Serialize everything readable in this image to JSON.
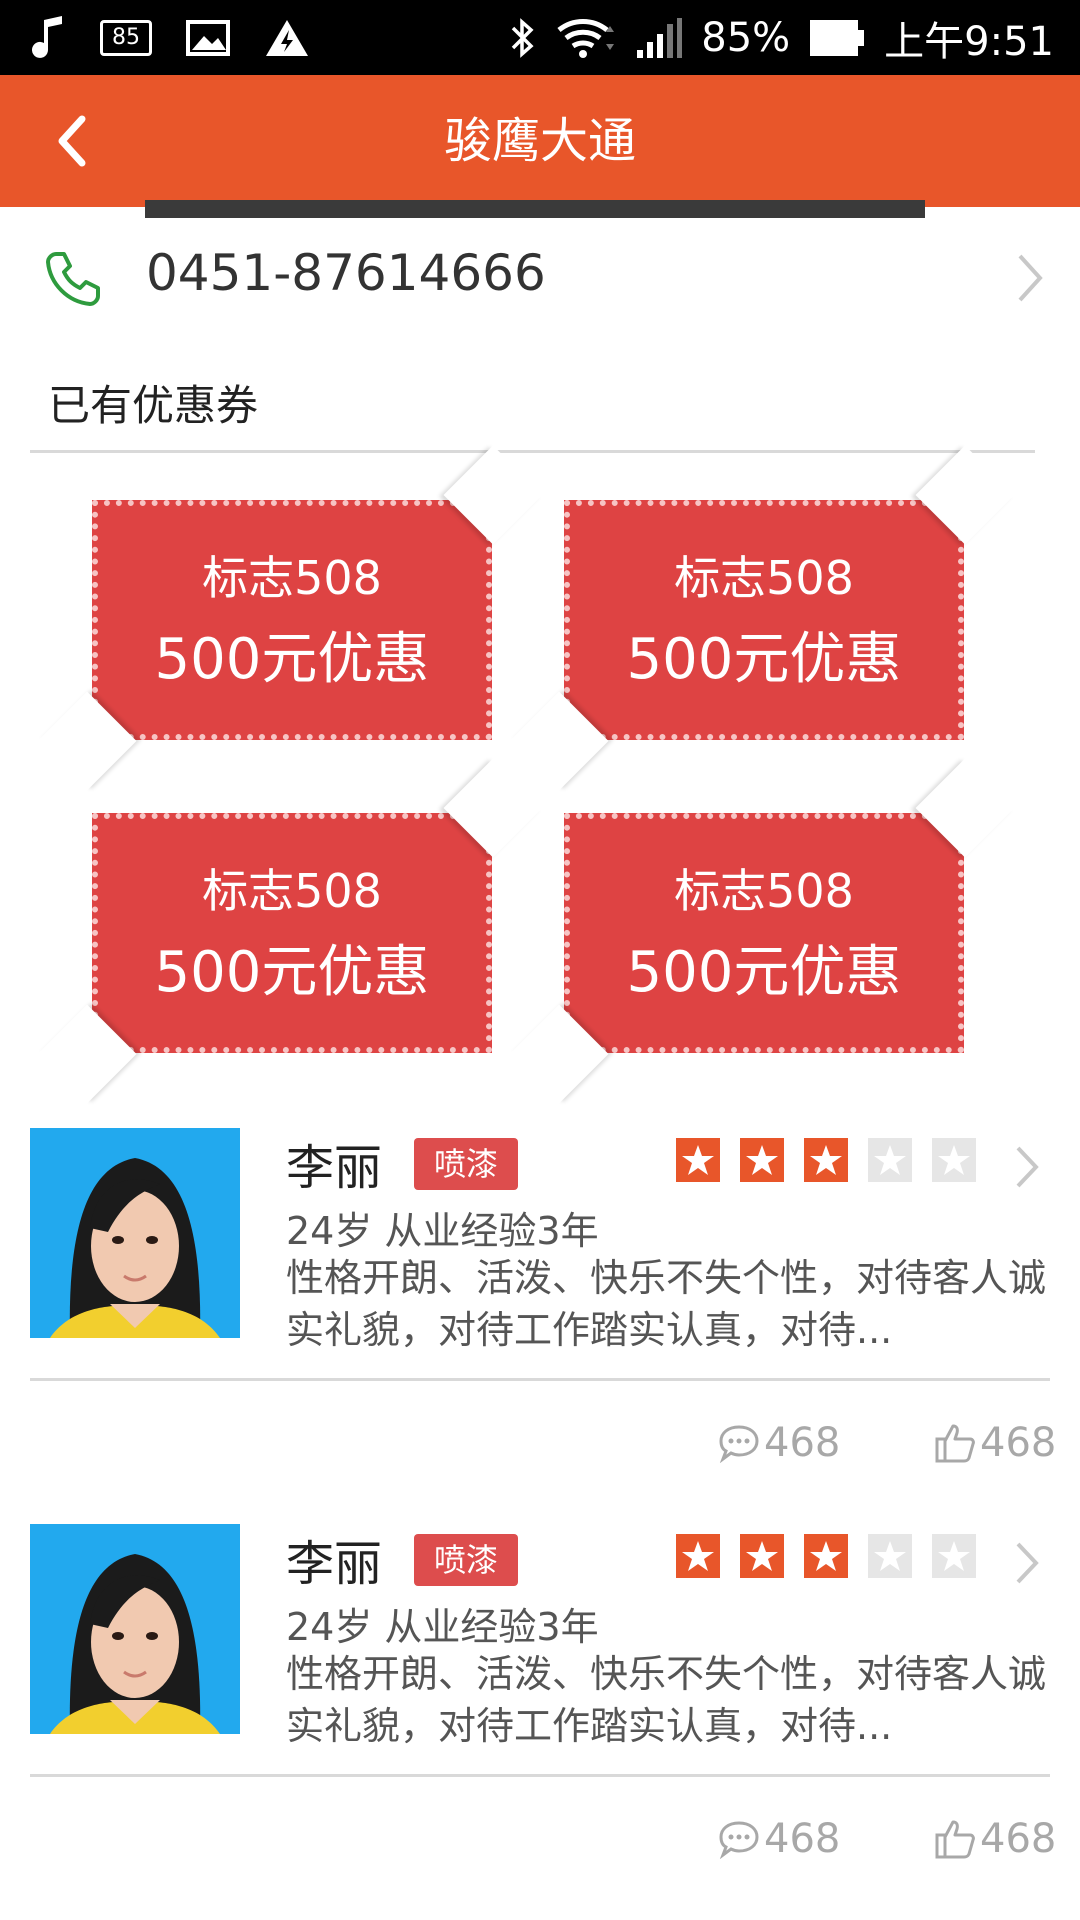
{
  "status_bar": {
    "battery_percent": "85%",
    "time": "上午9:51",
    "notification_badge": "85",
    "icons": [
      "music-note-icon",
      "notification-badge-icon",
      "image-icon",
      "warning-icon",
      "bluetooth-icon",
      "wifi-icon",
      "signal-icon",
      "battery-icon"
    ]
  },
  "header": {
    "title": "骏鹰大通",
    "back_icon": "chevron-left-icon"
  },
  "contact": {
    "phone": "0451-87614666",
    "phone_icon": "phone-icon"
  },
  "coupons_section": {
    "title": "已有优惠券",
    "coupons": [
      {
        "line1": "标志508",
        "line2": "500元优惠"
      },
      {
        "line1": "标志508",
        "line2": "500元优惠"
      },
      {
        "line1": "标志508",
        "line2": "500元优惠"
      },
      {
        "line1": "标志508",
        "line2": "500元优惠"
      }
    ]
  },
  "profiles": [
    {
      "name": "李丽",
      "tag": "喷漆",
      "rating": 3,
      "rating_max": 5,
      "age_experience": "24岁 从业经验3年",
      "description": "性格开朗、活泼、快乐不失个性，对待客人诚实礼貌，对待工作踏实认真，对待...",
      "comments": "468",
      "likes": "468"
    },
    {
      "name": "李丽",
      "tag": "喷漆",
      "rating": 3,
      "rating_max": 5,
      "age_experience": "24岁 从业经验3年",
      "description": "性格开朗、活泼、快乐不失个性，对待客人诚实礼貌，对待工作踏实认真，对待...",
      "comments": "468",
      "likes": "468"
    }
  ],
  "colors": {
    "header": "#e8562a",
    "coupon": "#de4343",
    "star_active": "#e8562a",
    "star_inactive": "#e6e6e6",
    "tag": "#dd4d4d"
  }
}
